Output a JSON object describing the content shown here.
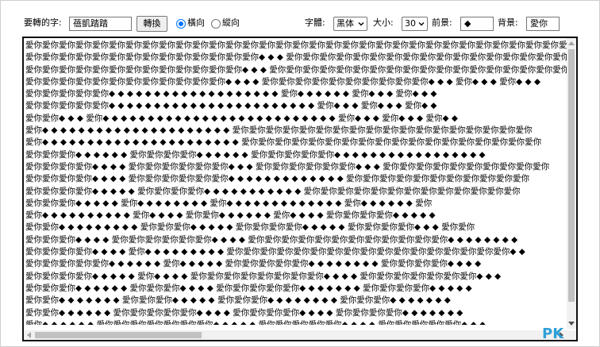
{
  "toolbar": {
    "word_label": "要轉的字:",
    "word_value": "蓓凱踏踏",
    "convert_button": "轉換",
    "radio_horizontal": "橫向",
    "radio_vertical": "縱向",
    "font_label": "字體:",
    "font_value": "黑体",
    "size_label": "大小:",
    "size_value": "30",
    "foreground_label": "前景:",
    "foreground_value": "◆",
    "background_label": "背景:",
    "background_value": "愛你"
  },
  "output": {
    "text": "愛你愛你愛你愛你愛你愛你愛你愛你愛你愛你愛你愛你愛你愛你愛你愛你愛你愛你愛你愛你愛你愛你愛你愛你愛你愛你愛你愛你愛你愛你愛你愛你愛你愛你愛你愛你愛你愛你愛你愛你\n愛你愛你愛你愛你愛你愛你愛你愛你愛你愛你愛你愛你愛你愛你◆ ◆ ◆ 愛你愛你愛你愛你愛你愛你愛你愛你愛你愛你愛你愛你愛你愛你愛你愛你愛你愛你愛你愛你愛你\n愛你愛你愛你愛你愛你愛你愛你愛你愛你愛你愛你愛你愛你◆ ◆ ◆ 愛你愛你愛你愛你愛你愛你愛你愛你愛你愛你愛你愛你愛你愛你愛你愛你愛你愛你愛你愛你愛你愛你\n愛你愛你愛你愛你愛你愛你愛你愛你愛你愛你愛你愛你◆ ◆ ◆ ◆ 愛你愛你愛你愛你愛你愛你愛你愛你愛你愛你◆ ◆ ◆ 愛你◆ ◆ ◆ 愛你◆ ◆ ◆\n愛你愛你愛你愛你愛你◆ ◆ ◆ ◆ ◆ ◆ ◆ ◆ ◆ ◆ ◆ ◆ ◆ ◆ ◆ ◆ ◆ ◆ ◆ 愛你◆ ◆ ◆ ◆ ◆ ◆ 愛你◆ ◆ ◆ 愛你◆ ◆ ◆\n愛你愛你愛你愛你愛你◆ ◆ ◆ ◆ ◆ ◆ ◆ ◆ ◆ ◆ ◆ ◆ ◆ ◆ ◆ ◆ ◆ ◆ ◆ ◆ ◆ ◆ ◆ 愛你◆ ◆ ◆ 愛你◆ ◆ ◆ 愛你◆ ◆\n愛你愛你◆ ◆ ◆ 愛你◆ ◆ ◆ ◆ ◆ ◆ ◆ ◆ ◆ ◆ ◆ ◆ ◆ ◆ ◆ ◆ ◆ ◆ ◆ ◆ ◆ ◆ ◆ ◆ ◆ ◆ 愛你◆ ◆ ◆ 愛你◆ ◆ ◆ 愛你◆ ◆\n愛你◆ ◆ ◆ ◆ ◆ ◆ ◆ ◆ ◆ ◆ ◆ ◆ ◆ ◆ ◆ ◆ ◆ ◆ ◆ ◆ ◆ 愛你愛你愛你愛你愛你愛你愛你愛你愛你愛你愛你愛你愛你愛你愛你愛你愛你愛你\n愛你◆ ◆ ◆ ◆ ◆ ◆ ◆ ◆ ◆ ◆ ◆ ◆ ◆ ◆ ◆ ◆ ◆ ◆ ◆ ◆ ◆ ◆ 愛你愛你愛你愛你愛你愛你愛你愛你愛你愛你愛你愛你愛你愛你愛你愛你愛你愛你\n愛你愛你愛你◆ ◆ ◆ ◆ ◆ ◆ 愛你愛你愛你愛你◆ ◆ ◆ ◆ ◆ ◆ 愛你愛你愛你愛你愛你◆ ◆ ◆ ◆ ◆ ◆ ◆ ◆ ◆ ◆ ◆ ◆ ◆ ◆ ◆ ◆ ◆\n愛你愛你愛你愛你◆ ◆ ◆ ◆ 愛你愛你愛你愛你愛你愛你◆ ◆ ◆ 愛你愛你愛你愛你愛你愛你◆ ◆ ◆ 愛你愛你愛你愛你愛你愛你愛你愛你愛你愛你\n愛你愛你愛你愛你◆ ◆ ◆ ◆ 愛你愛你愛你愛你愛你愛你◆ ◆ ◆ ◆ ◆ ◆ ◆ ◆ ◆ ◆ ◆ ◆ ◆ 愛你愛你愛你愛你愛你愛你愛你愛你愛你愛你愛你\n愛你愛你愛你愛你◆ ◆ ◆ ◆ ◆ 愛你愛你愛你愛你◆ ◆ ◆ ◆ ◆ ◆ ◆ ◆ ◆ ◆ ◆ 愛你愛你愛你愛你愛你愛你愛你愛你愛你愛你愛你愛你愛你\n愛你愛你愛你◆ ◆ ◆ ◆ ◆ 愛你◆ ◆ ◆ ◆ ◆ ◆ ◆ ◆ 愛你◆ ◆ ◆ ◆ ◆ ◆ ◆ ◆ ◆ ◆ ◆ ◆ ◆ 愛你◆ ◆ ◆ ◆ ◆ ◆ 愛你\n愛你◆ ◆ ◆ ◆ ◆ ◆ ◆ ◆ ◆ ◆ 愛你◆ ◆ ◆ ◆ 愛你愛你◆ ◆ ◆ ◆ ◆ ◆ 愛你◆ ◆ ◆ ◆ 愛你愛你愛你愛你◆ ◆ ◆ ◆ ◆\n愛你愛你◆ ◆ ◆ ◆ ◆ ◆ ◆ ◆ ◆ 愛你愛你愛你◆ ◆ ◆ ◆ ◆ 愛你愛你愛你愛你◆ ◆ ◆ ◆ ◆ 愛你愛你愛你愛你◆ ◆ ◆ 愛你愛你\n愛你愛你愛你◆ ◆ ◆ ◆ 愛你愛你愛你愛你愛你愛你◆ ◆ ◆ ◆ 愛你愛你愛你愛你愛你愛你愛你愛你愛你愛你愛你愛你◆ ◆ ◆ ◆ ◆ ◆ ◆ ◆\n愛你愛你愛你愛你◆ ◆ ◆ ◆ 愛你◆ ◆ ◆ ◆ ◆ ◆ ◆ ◆ ◆ 愛你愛你愛你愛你愛你愛你愛你愛你愛你愛你愛你愛你愛你愛你愛你愛你愛你◆ ◆\n愛你愛你愛你愛你愛你◆ ◆ ◆ ◆ ◆ ◆ 愛你◆ ◆ ◆ ◆ ◆ 愛你愛你愛你愛你愛你◆ ◆ ◆ ◆ ◆ ◆ ◆ ◆ 愛你愛你愛你愛你◆ ◆ ◆ ◆\n愛你愛你愛你愛你◆ ◆ ◆ ◆ ◆ 愛你◆ ◆ ◆ ◆ 愛你愛你愛你愛你愛你愛你愛你愛你◆ ◆ ◆ ◆ 愛你愛你愛你愛你愛你愛你愛你◆ ◆ ◆\n愛你愛你愛你◆ ◆ ◆ ◆ ◆ ◆ 愛你愛你愛你◆ ◆ ◆ ◆ 愛你愛你愛你愛你愛你◆ ◆ ◆ ◆ ◆ ◆ ◆ 愛你愛你愛你愛你◆ ◆ ◆ ◆ ◆\n愛你愛你◆ ◆ ◆ ◆ ◆ ◆ ◆ 愛你愛你愛你◆ ◆ ◆ ◆ ◆ 愛你愛你愛你◆ ◆ ◆ ◆ ◆ ◆ ◆ ◆ 愛你愛你愛你◆ ◆ ◆ ◆ ◆ ◆ ◆\n愛你愛你◆ ◆ ◆ ◆ ◆ ◆ 愛你愛你愛你愛你愛你◆ ◆ ◆ ◆ 愛你愛你愛你愛你◆ ◆ ◆ ◆ 愛你愛你愛你愛你◆ ◆ ◆ ◆ ◆ ◆ ◆\n愛你◆ ◆ ◆ ◆ ◆ ◆ 愛你愛你愛你愛你愛你愛你愛你◆ ◆ ◆ ◆ ◆ 愛你愛你愛你愛你愛你◆ ◆ ◆ ◆ 愛你愛你愛你愛你愛你◆ ◆ ◆\n愛你愛你愛你◆ ◆ ◆ ◆ 愛你愛你愛你愛你愛你愛你愛你愛你◆ ◆ ◆ ◆ 愛你愛你愛你愛你愛你愛你◆ ◆ ◆ ◆ 愛你愛你愛你愛你愛你\n愛你愛你愛你愛你愛你愛你愛你愛你愛你愛你愛你愛你愛你愛你愛你愛你愛你愛你愛你愛你愛你愛你愛你愛你愛你愛你愛你愛你愛你愛你愛你愛你愛你愛你愛你愛你愛你愛你愛你愛你"
  },
  "watermark": {
    "main": "PK",
    "sub": ""
  },
  "colors": {
    "accent": "#0075ff",
    "border": "#111111",
    "logo": "#2e9fd8"
  }
}
